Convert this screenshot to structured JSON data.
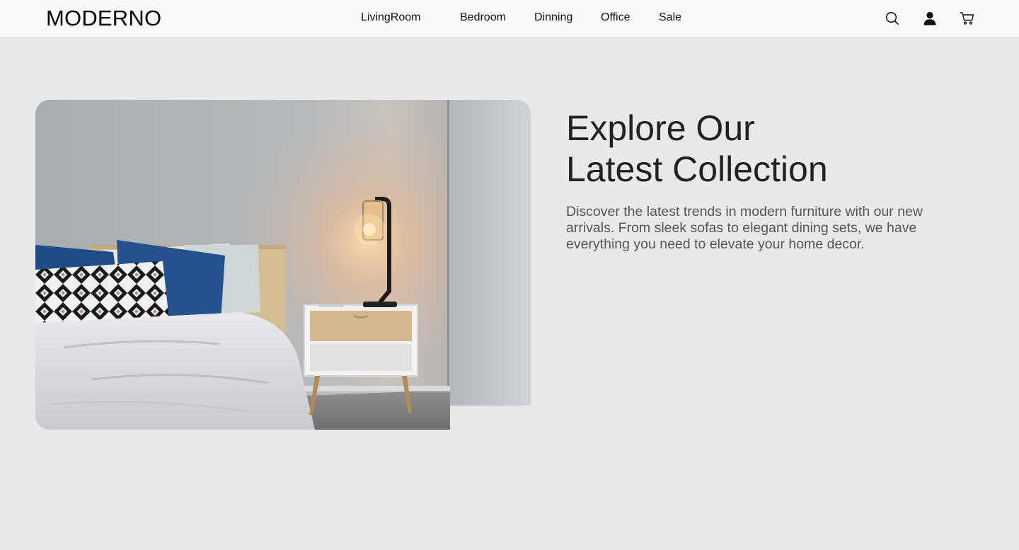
{
  "header": {
    "logo": "MODERNO",
    "nav": [
      {
        "label": "LivingRoom"
      },
      {
        "label": "Bedroom"
      },
      {
        "label": "Dinning"
      },
      {
        "label": "Office"
      },
      {
        "label": "Sale"
      }
    ],
    "icons": [
      "search-icon",
      "user-icon",
      "cart-icon"
    ]
  },
  "hero": {
    "title_line1": "Explore Our",
    "title_line2": "Latest Collection",
    "description": "Discover the latest trends in modern furniture with our new arrivals. From sleek sofas to elegant dining sets, we have everything you need to elevate your home decor."
  },
  "colors": {
    "page_bg": "#e8e9eb",
    "header_bg": "#f9f9f8",
    "text": "#222222",
    "muted_text": "#555555"
  }
}
